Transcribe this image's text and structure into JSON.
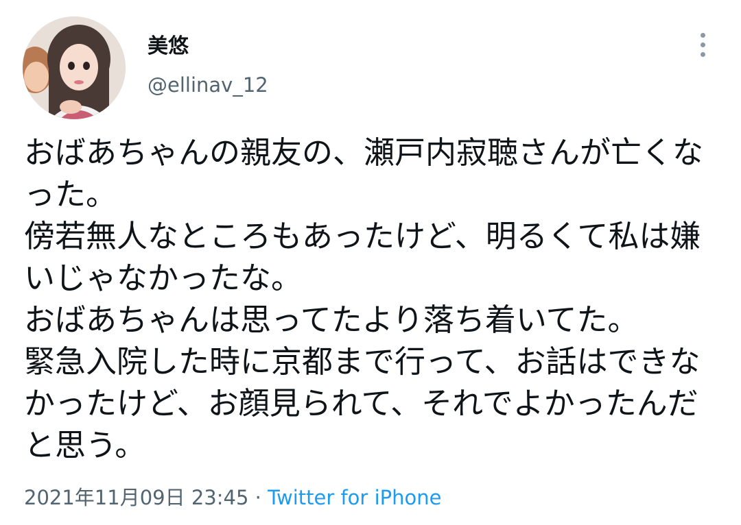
{
  "author": {
    "display_name": "美悠",
    "handle": "@ellinav_12",
    "avatar_icon": "profile-photo"
  },
  "tweet": {
    "text": "おばあちゃんの親友の、瀬戸内寂聴さんが亡くなった。\n傍若無人なところもあったけど、明るくて私は嫌いじゃなかったな。\nおばあちゃんは思ってたより落ち着いてた。\n緊急入院した時に京都まで行って、お話はできなかったけど、お顔見られて、それでよかったんだと思う。",
    "timestamp": "2021年11月09日 23:45",
    "separator": "·",
    "source": "Twitter for iPhone"
  },
  "menu": {
    "icon": "more-vertical-icon"
  },
  "colors": {
    "text": "#0f1419",
    "secondary": "#536471",
    "link": "#1d9bf0"
  }
}
